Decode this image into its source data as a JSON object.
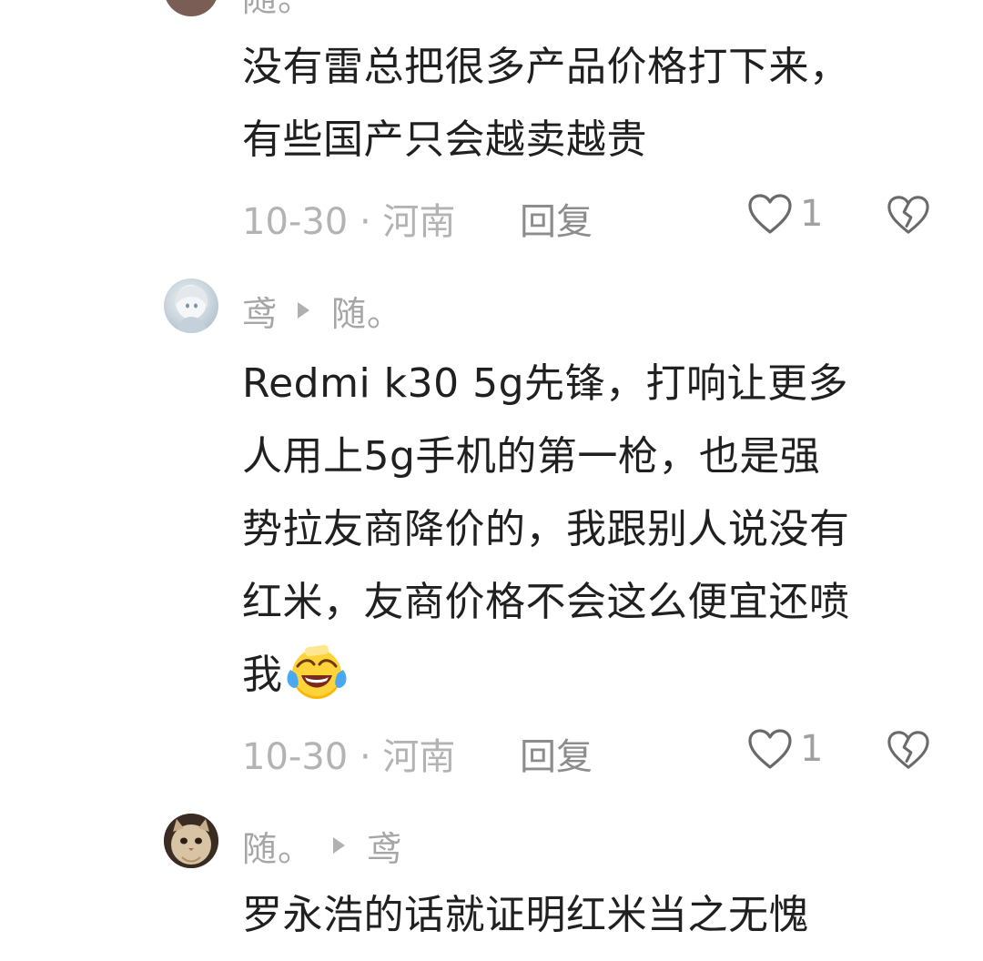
{
  "top_partial": {
    "name": "随。"
  },
  "comments": [
    {
      "body_lines": [
        "没有雷总把很多产品价格打下来，",
        "有些国产只会越卖越贵"
      ],
      "date": "10-30",
      "separator": "·",
      "location": "河南",
      "reply_label": "回复",
      "like_count": "1",
      "icons": {
        "like": "heart-outline-icon",
        "dislike": "broken-heart-icon"
      }
    },
    {
      "author": "鸢",
      "reply_to": "随。",
      "avatar": "avatar-white-hair-anime",
      "body_lines": [
        "Redmi k30 5g先锋，打响让更多",
        "人用上5g手机的第一枪，也是强",
        "势拉友商降价的，我跟别人说没有",
        "红米，友商价格不会这么便宜还喷",
        "我"
      ],
      "emoji": "face-with-tears-of-joy-icon",
      "date": "10-30",
      "separator": "·",
      "location": "河南",
      "reply_label": "回复",
      "like_count": "1",
      "icons": {
        "like": "heart-outline-icon",
        "dislike": "broken-heart-icon"
      }
    },
    {
      "author": "随。",
      "reply_to": "鸢",
      "avatar": "avatar-cat",
      "body_lines": [
        "罗永浩的话就证明红米当之无愧"
      ]
    }
  ],
  "colors": {
    "text": "#202020",
    "meta": "#b3b3b3",
    "name": "#a6a6a6"
  }
}
